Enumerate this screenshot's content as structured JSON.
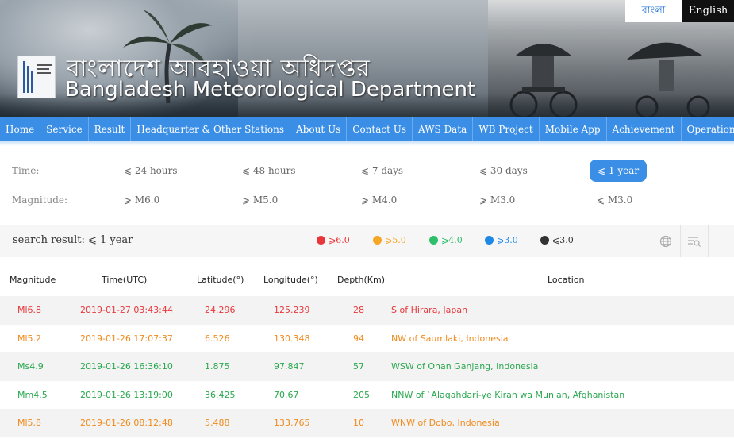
{
  "lang": {
    "bangla": "বাংলা",
    "english": "English"
  },
  "header": {
    "title_bn": "বাংলাদেশ আবহাওয়া অধিদপ্তর",
    "title_en": "Bangladesh Meteorological Department"
  },
  "nav": {
    "items": [
      "Home",
      "Service",
      "Result",
      "Headquarter & Other Stations",
      "About Us",
      "Contact Us",
      "AWS Data",
      "WB Project",
      "Mobile App",
      "Achievement",
      "Operational NWP"
    ]
  },
  "filters": {
    "time_label": "Time:",
    "time_options": [
      "⩽ 24 hours",
      "⩽ 48 hours",
      "⩽ 7 days",
      "⩽ 30 days",
      "⩽ 1 year"
    ],
    "time_selected": "⩽ 1 year",
    "magnitude_label": "Magnitude:",
    "magnitude_options": [
      "⩾ M6.0",
      "⩾ M5.0",
      "⩾ M4.0",
      "⩾ M3.0",
      "⩽ M3.0"
    ]
  },
  "result": {
    "title": "search result: ⩽ 1 year",
    "legend": [
      {
        "label": "⩾6.0",
        "color": "#e8373a"
      },
      {
        "label": "⩾5.0",
        "color": "#f5a623"
      },
      {
        "label": "⩾4.0",
        "color": "#2dbf6a"
      },
      {
        "label": "⩾3.0",
        "color": "#1e88e5"
      },
      {
        "label": "⩽3.0",
        "color": "#333333"
      }
    ],
    "icons": [
      "globe-icon",
      "list-search-icon"
    ]
  },
  "table": {
    "headers": [
      "Magnitude",
      "Time(UTC)",
      "Latitude(°)",
      "Longitude(°)",
      "Depth(Km)",
      "Location"
    ],
    "rows": [
      {
        "magnitude": "Ml6.8",
        "time": "2019-01-27 03:43:44",
        "lat": "24.296",
        "lon": "125.239",
        "depth": "28",
        "location": "S of Hirara, Japan",
        "color": "#e8373a"
      },
      {
        "magnitude": "Ml5.2",
        "time": "2019-01-26 17:07:37",
        "lat": "6.526",
        "lon": "130.348",
        "depth": "94",
        "location": "NW of Saumlaki, Indonesia",
        "color": "#f08a1c"
      },
      {
        "magnitude": "Ms4.9",
        "time": "2019-01-26 16:36:10",
        "lat": "1.875",
        "lon": "97.847",
        "depth": "57",
        "location": "WSW of Onan Ganjang, Indonesia",
        "color": "#2aa84f"
      },
      {
        "magnitude": "Mm4.5",
        "time": "2019-01-26 13:19:00",
        "lat": "36.425",
        "lon": "70.67",
        "depth": "205",
        "location": "NNW of `Alaqahdari-ye Kiran wa Munjan, Afghanistan",
        "color": "#2aa84f"
      },
      {
        "magnitude": "Ml5.8",
        "time": "2019-01-26 08:12:48",
        "lat": "5.488",
        "lon": "133.765",
        "depth": "10",
        "location": "WNW of Dobo, Indonesia",
        "color": "#f08a1c"
      }
    ]
  }
}
